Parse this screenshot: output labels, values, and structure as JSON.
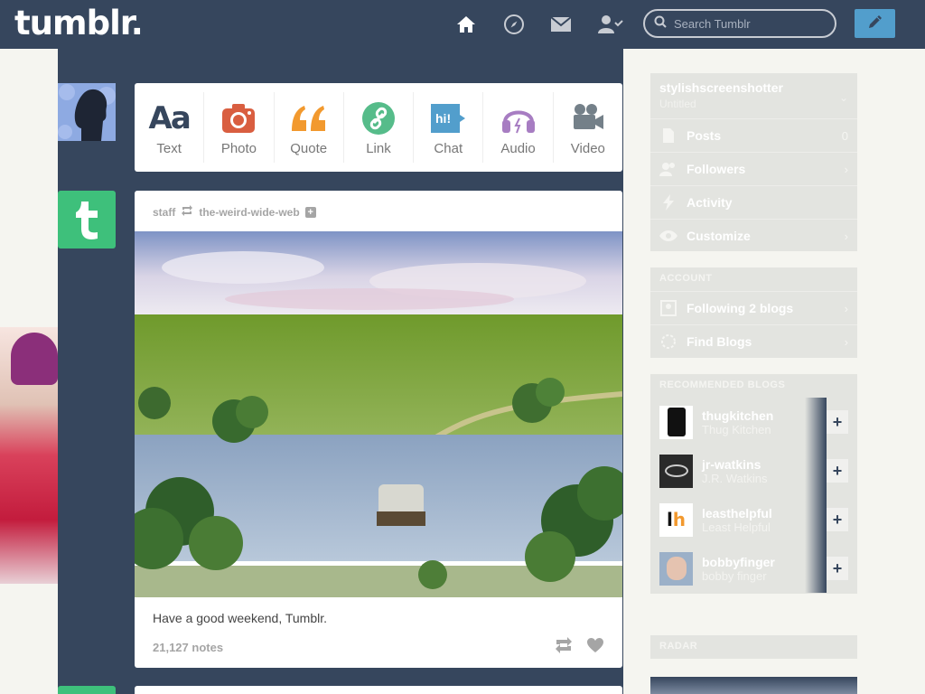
{
  "topbar": {
    "logo": "tumblr.",
    "search_placeholder": "Search Tumblr"
  },
  "post_types": [
    {
      "label": "Text",
      "icon": "text-icon",
      "color": "#36465d"
    },
    {
      "label": "Photo",
      "icon": "camera-icon",
      "color": "#d95e40"
    },
    {
      "label": "Quote",
      "icon": "quote-icon",
      "color": "#f2992e"
    },
    {
      "label": "Link",
      "icon": "link-icon",
      "color": "#56bc8a"
    },
    {
      "label": "Chat",
      "icon": "chat-icon",
      "color": "#529ecc"
    },
    {
      "label": "Audio",
      "icon": "headphones-icon",
      "color": "#a77dc2"
    },
    {
      "label": "Video",
      "icon": "video-camera-icon",
      "color": "#748089"
    }
  ],
  "post": {
    "author": "staff",
    "reblogged_from": "the-weird-wide-web",
    "caption": "Have a good weekend, Tumblr.",
    "notes": "21,127 notes"
  },
  "sidebar": {
    "blog": {
      "name": "stylishscreenshotter",
      "subtitle": "Untitled",
      "items": [
        {
          "label": "Posts",
          "value": "0"
        },
        {
          "label": "Followers",
          "value": "›"
        },
        {
          "label": "Activity",
          "value": ""
        },
        {
          "label": "Customize",
          "value": "›"
        }
      ]
    },
    "account": {
      "heading": "ACCOUNT",
      "items": [
        {
          "label": "Following 2 blogs"
        },
        {
          "label": "Find Blogs"
        }
      ]
    },
    "recommended": {
      "heading": "RECOMMENDED BLOGS",
      "blogs": [
        {
          "name": "thugkitchen",
          "title": "Thug Kitchen"
        },
        {
          "name": "jr-watkins",
          "title": "J.R. Watkins"
        },
        {
          "name": "leasthelpful",
          "title": "Least Helpful"
        },
        {
          "name": "bobbyfinger",
          "title": "bobby finger"
        }
      ],
      "follow_label": "+"
    },
    "radar_heading": "RADAR"
  },
  "colors": {
    "navy": "#36465d",
    "accent": "#529ecc",
    "green": "#3ec07b"
  }
}
